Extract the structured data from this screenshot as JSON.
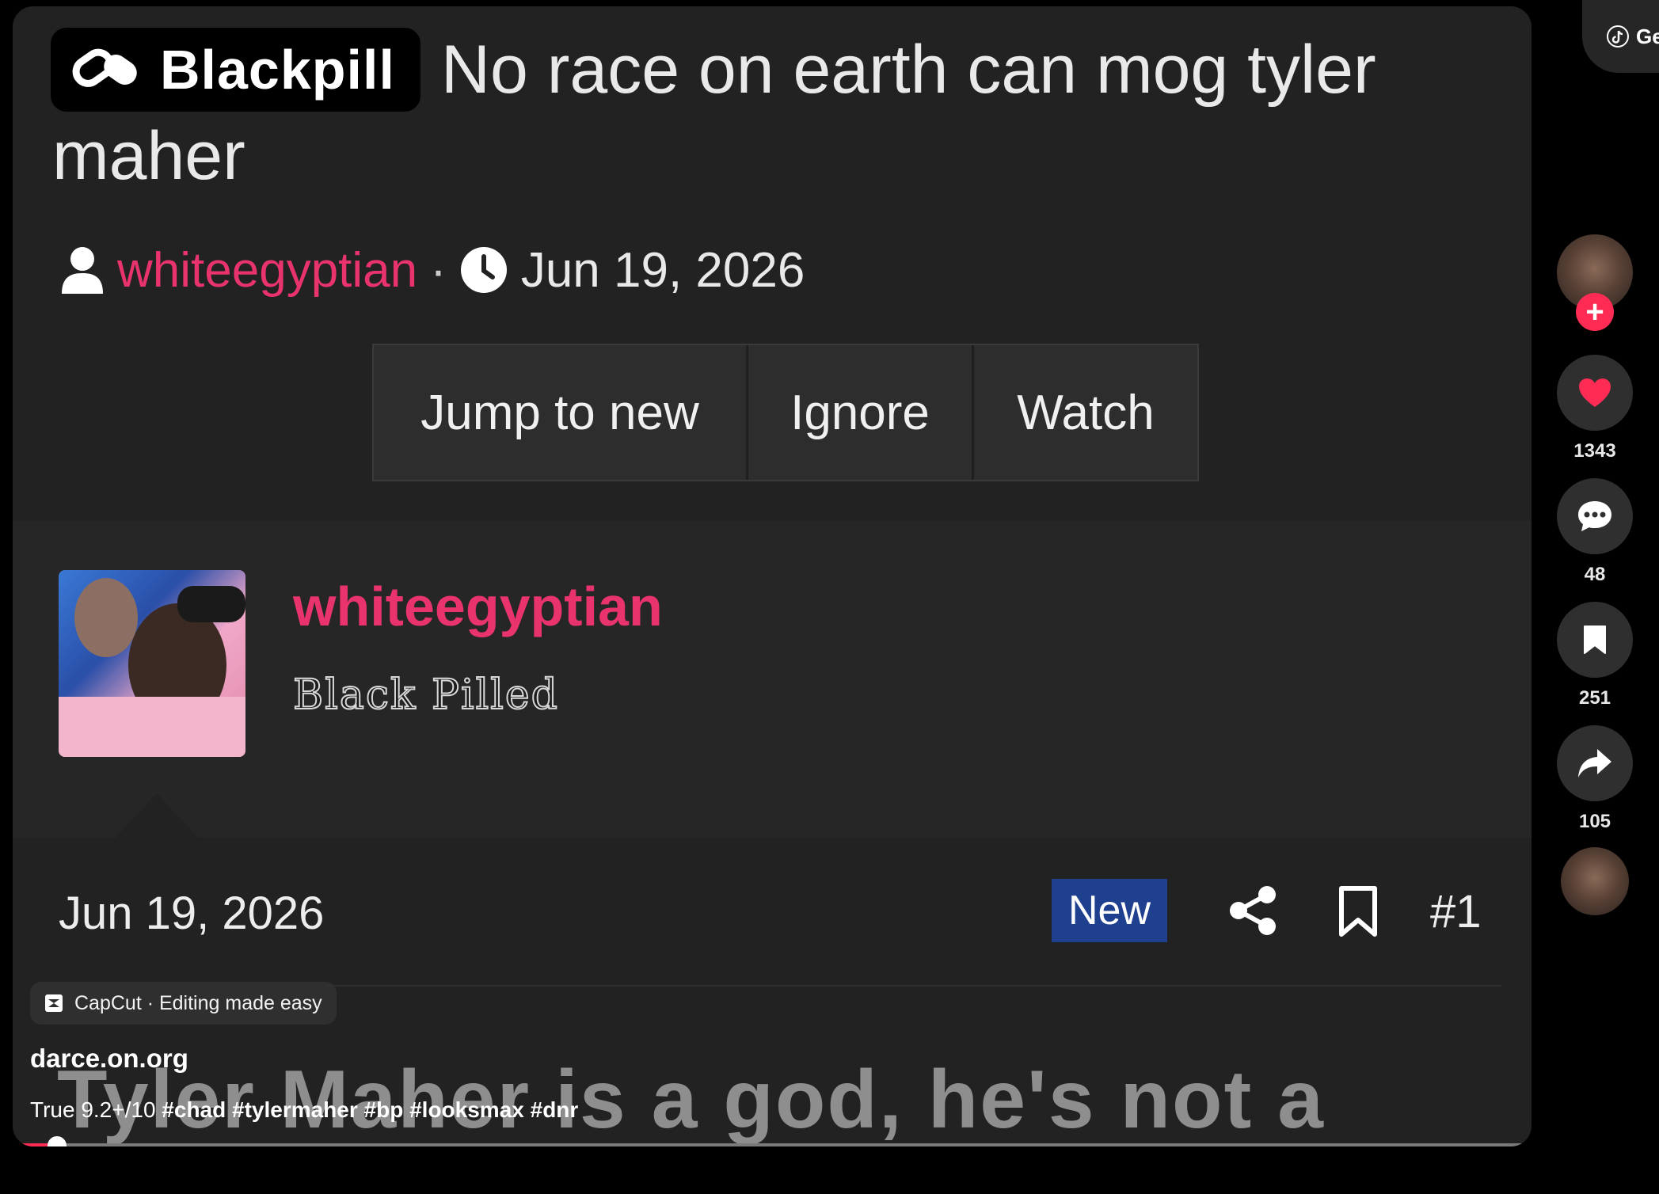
{
  "thread": {
    "prefix_badge": "Blackpill",
    "title_line1": "No race on earth can mog tyler",
    "title_line2": "maher",
    "author": "whiteegyptian",
    "separator": "·",
    "date": "Jun 19, 2026"
  },
  "thread_actions": [
    "Jump to new",
    "Ignore",
    "Watch"
  ],
  "post": {
    "username": "whiteegyptian",
    "rank": "Black Pilled",
    "date": "Jun 19, 2026",
    "new_badge": "New",
    "number": "#1"
  },
  "caption_overlay": "Tyler Maher is a god, he's not a",
  "video_info": {
    "capcut_label": "CapCut · Editing made easy",
    "account": "darce.on.org",
    "description_prefix": "True 9.2+/10 ",
    "hashtags": "#chad #tylermaher #bp #looksmax #dnr"
  },
  "sidebar": {
    "likes": "1343",
    "comments": "48",
    "saves": "251",
    "shares": "105",
    "get_app_label": "Ge"
  },
  "playback": {
    "progress_fraction": 0.02
  },
  "colors": {
    "accent_pink": "#e8336d",
    "tiktok_red": "#fe2c55",
    "new_badge_blue": "#1f3f8f"
  },
  "icons": [
    "pill-icon",
    "user-icon",
    "clock-icon",
    "share-icon",
    "bookmark-icon",
    "heart-icon",
    "comment-icon",
    "save-icon",
    "share-arrow-icon",
    "capcut-icon",
    "tiktok-icon"
  ]
}
